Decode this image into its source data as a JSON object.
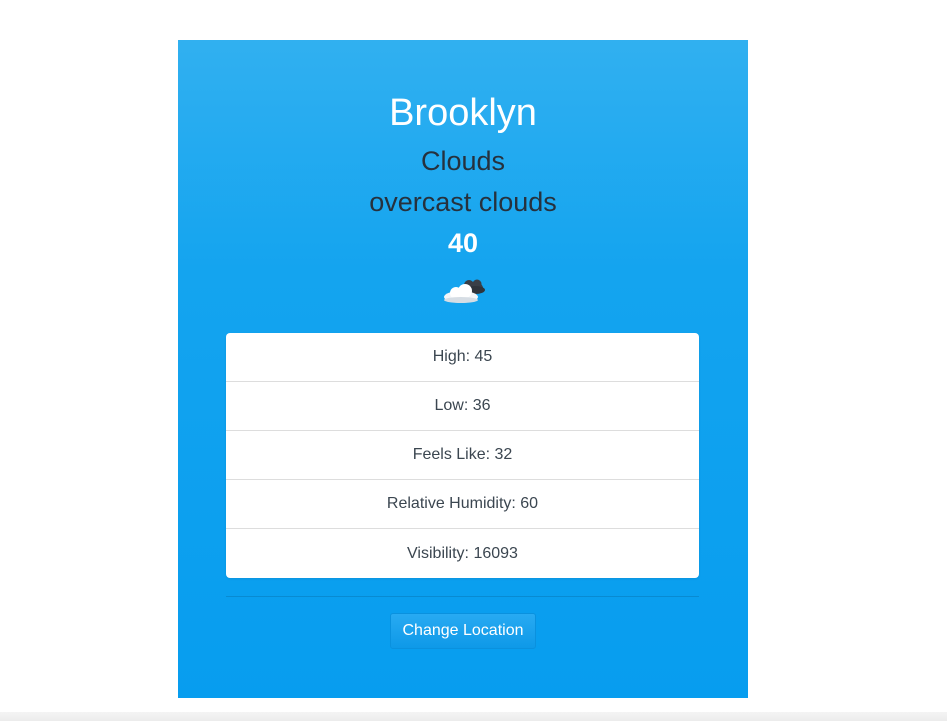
{
  "location": {
    "city": "Brooklyn",
    "condition": "Clouds",
    "description": "overcast clouds",
    "temperature": "40",
    "icon": "overcast-clouds-icon"
  },
  "stats": [
    {
      "label": "High: 45"
    },
    {
      "label": "Low: 36"
    },
    {
      "label": "Feels Like: 32"
    },
    {
      "label": "Relative Humidity: 60"
    },
    {
      "label": "Visibility: 16093"
    }
  ],
  "actions": {
    "change_location_label": "Change Location"
  },
  "colors": {
    "card_background": "#079def",
    "primary_text": "#ffffff",
    "secondary_text": "#26313d",
    "button": "#0e99e8"
  }
}
